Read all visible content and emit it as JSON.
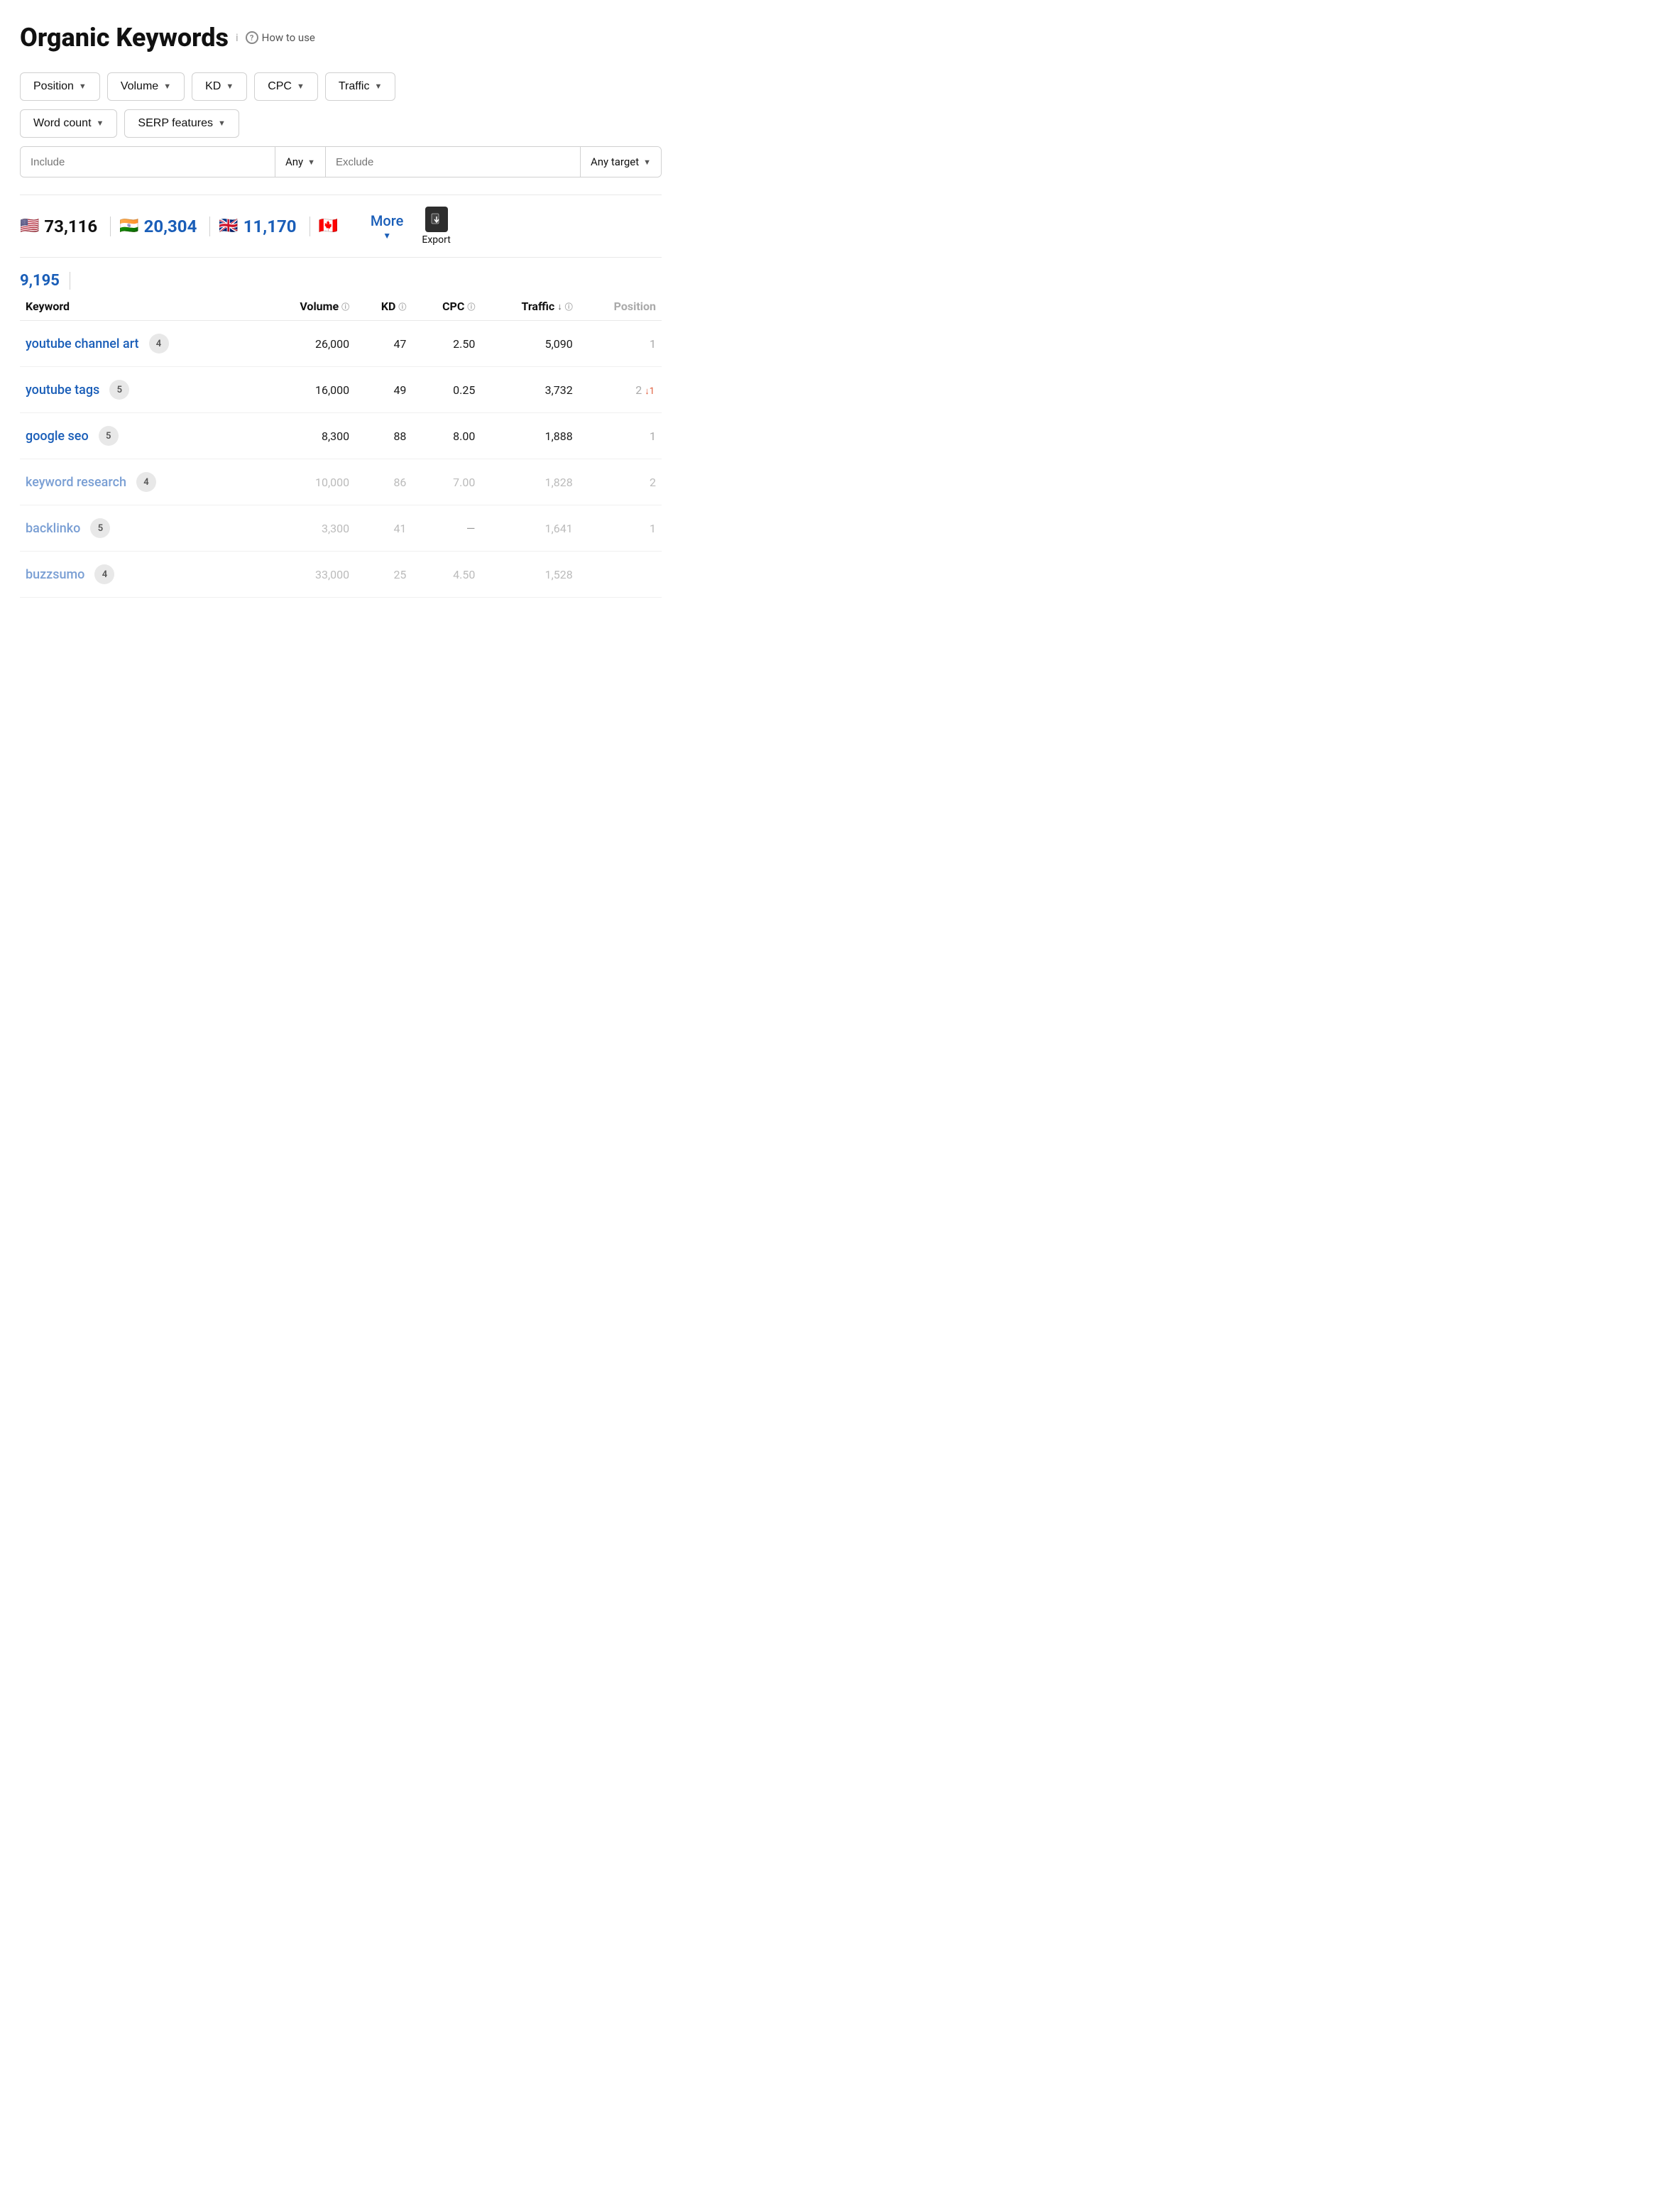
{
  "header": {
    "title": "Organic Keywords",
    "info_icon": "i",
    "how_to_use": "How to use"
  },
  "filters": {
    "row1": [
      {
        "label": "Position",
        "id": "position"
      },
      {
        "label": "Volume",
        "id": "volume"
      },
      {
        "label": "KD",
        "id": "kd"
      },
      {
        "label": "CPC",
        "id": "cpc"
      },
      {
        "label": "Traffic",
        "id": "traffic"
      }
    ],
    "row2": [
      {
        "label": "Word count",
        "id": "word-count"
      },
      {
        "label": "SERP features",
        "id": "serp-features"
      }
    ],
    "include_placeholder": "Include",
    "any_label": "Any",
    "exclude_placeholder": "Exclude",
    "any_target_label": "Any target"
  },
  "stats": {
    "countries": [
      {
        "flag": "🇺🇸",
        "count": "73,116",
        "color": "black"
      },
      {
        "flag": "🇮🇳",
        "count": "20,304",
        "color": "blue"
      },
      {
        "flag": "🇬🇧",
        "count": "11,170",
        "color": "blue"
      },
      {
        "flag": "🇨🇦",
        "count": "",
        "color": "blue"
      }
    ],
    "more_label": "More",
    "second_row_count": "9,195",
    "export_label": "Export"
  },
  "table": {
    "columns": [
      {
        "label": "Keyword",
        "id": "keyword",
        "info": false,
        "sort": false
      },
      {
        "label": "Volume",
        "id": "volume",
        "info": true,
        "sort": false
      },
      {
        "label": "KD",
        "id": "kd",
        "info": true,
        "sort": false
      },
      {
        "label": "CPC",
        "id": "cpc",
        "info": true,
        "sort": false
      },
      {
        "label": "Traffic",
        "id": "traffic",
        "info": true,
        "sort": true
      },
      {
        "label": "Position",
        "id": "position",
        "info": false,
        "sort": false,
        "grey": true
      }
    ],
    "rows": [
      {
        "keyword": "youtube channel art",
        "badge": "4",
        "volume": "26,000",
        "kd": "47",
        "cpc": "2.50",
        "traffic": "5,090",
        "position": "1",
        "position_trend": null,
        "faded": false
      },
      {
        "keyword": "youtube tags",
        "badge": "5",
        "volume": "16,000",
        "kd": "49",
        "cpc": "0.25",
        "traffic": "3,732",
        "position": "2",
        "position_trend": "↓1",
        "faded": false
      },
      {
        "keyword": "google seo",
        "badge": "5",
        "volume": "8,300",
        "kd": "88",
        "cpc": "8.00",
        "traffic": "1,888",
        "position": "1",
        "position_trend": null,
        "faded": false
      },
      {
        "keyword": "keyword research",
        "badge": "4",
        "volume": "10,000",
        "kd": "86",
        "cpc": "7.00",
        "traffic": "1,828",
        "position": "2",
        "position_trend": null,
        "faded": true
      },
      {
        "keyword": "backlinko",
        "badge": "5",
        "volume": "3,300",
        "kd": "41",
        "cpc": "—",
        "traffic": "1,641",
        "position": "1",
        "position_trend": null,
        "faded": true
      },
      {
        "keyword": "buzzsumo",
        "badge": "4",
        "volume": "33,000",
        "kd": "25",
        "cpc": "4.50",
        "traffic": "1,528",
        "position": "",
        "position_trend": null,
        "faded": true
      }
    ]
  }
}
